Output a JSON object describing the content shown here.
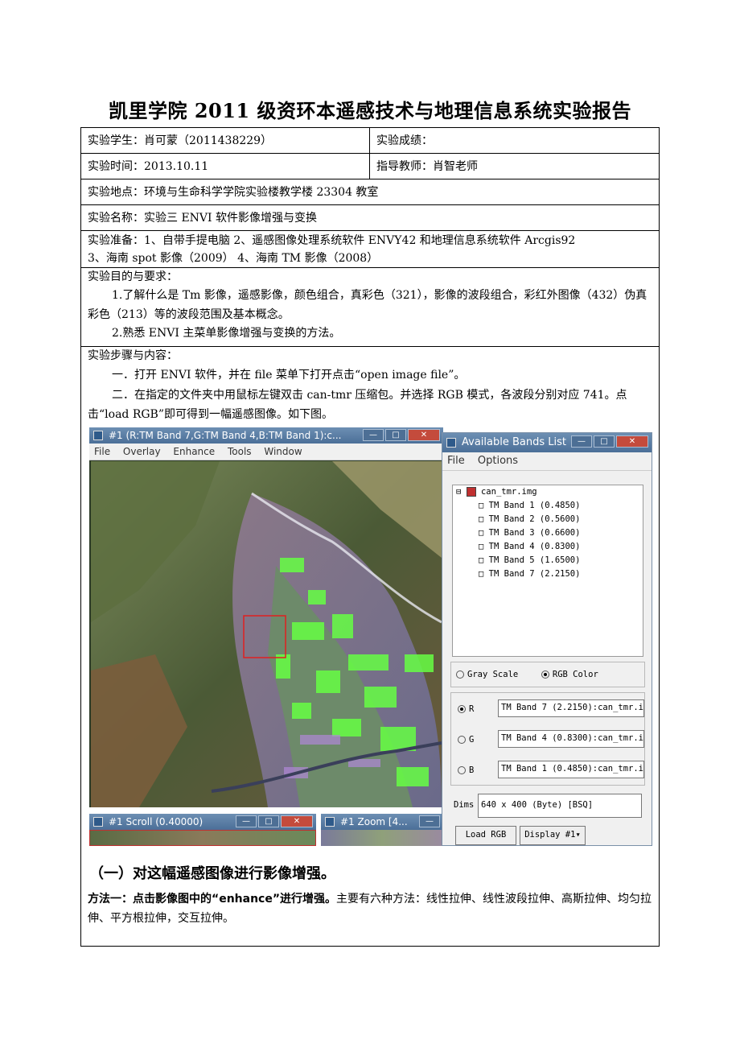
{
  "title": "凯里学院 2011 级资环本遥感技术与地理信息系统实验报告",
  "rows": {
    "student": "实验学生：肖可蒙（2011438229）",
    "score": "实验成绩：",
    "time": "实验时间：2013.10.11",
    "teacher": "指导教师：肖智老师",
    "place": "实验地点：环境与生命科学学院实验楼教学楼 23304 教室",
    "name": "实验名称：实验三  ENVI 软件影像增强与变换",
    "prep_line1": "实验准备：1、自带手提电脑     2、遥感图像处理系统软件 ENVY42 和地理信息系统软件 Arcgis92",
    "prep_line2": "3、海南 spot 影像（2009）    4、海南 TM 影像（2008）"
  },
  "goals": {
    "heading": "实验目的与要求：",
    "item1": "1.了解什么是 Tm 影像，遥感影像，颜色组合，真彩色（321），影像的波段组合，彩红外图像（432）伪真彩色（213）等的波段范围及基本概念。",
    "item2": "2.熟悉 ENVI 主菜单影像增强与变换的方法。"
  },
  "steps": {
    "heading": "实验步骤与内容：",
    "step1": "一．打开 ENVI 软件，并在 file 菜单下打开点击“open image file”。",
    "step2": "二．在指定的文件夹中用鼠标左键双击 can-tmr 压缩包。并选择 RGB 模式，各波段分别对应 741。点击“load RGB”即可得到一幅遥感图像。如下图。"
  },
  "screenshot": {
    "image_window": {
      "title": "#1 (R:TM Band 7,G:TM Band 4,B:TM Band 1):c...",
      "menu": [
        "File",
        "Overlay",
        "Enhance",
        "Tools",
        "Window"
      ]
    },
    "scroll_window": {
      "title": "#1 Scroll (0.40000)"
    },
    "zoom_window": {
      "title": "#1 Zoom [4..."
    },
    "bands_window": {
      "title": "Available Bands List",
      "menu": [
        "File",
        "Options"
      ],
      "file": "can_tmr.img",
      "bands": [
        "TM Band 1  (0.4850)",
        "TM Band 2  (0.5600)",
        "TM Band 3  (0.6600)",
        "TM Band 4  (0.8300)",
        "TM Band 5  (1.6500)",
        "TM Band 7  (2.2150)"
      ],
      "gray_scale": "Gray Scale",
      "rgb_color": "RGB Color",
      "r_label": "R",
      "g_label": "G",
      "b_label": "B",
      "r_value": "TM Band 7  (2.2150):can_tmr.i",
      "g_value": "TM Band 4  (0.8300):can_tmr.i",
      "b_value": "TM Band 1  (0.4850):can_tmr.i",
      "dims_label": "Dims",
      "dims_value": "640 x 400  (Byte)  [BSQ]",
      "load_button": "Load RGB",
      "display_button": "Display #1"
    }
  },
  "section": {
    "heading": "（一）对这幅遥感图像进行影像增强。",
    "method_bold": "方法一：点击影像图中的“enhance”进行增强。",
    "method_text": "主要有六种方法：线性拉伸、线性波段拉伸、高斯拉伸、均匀拉伸、平方根拉伸，交互拉伸。"
  }
}
